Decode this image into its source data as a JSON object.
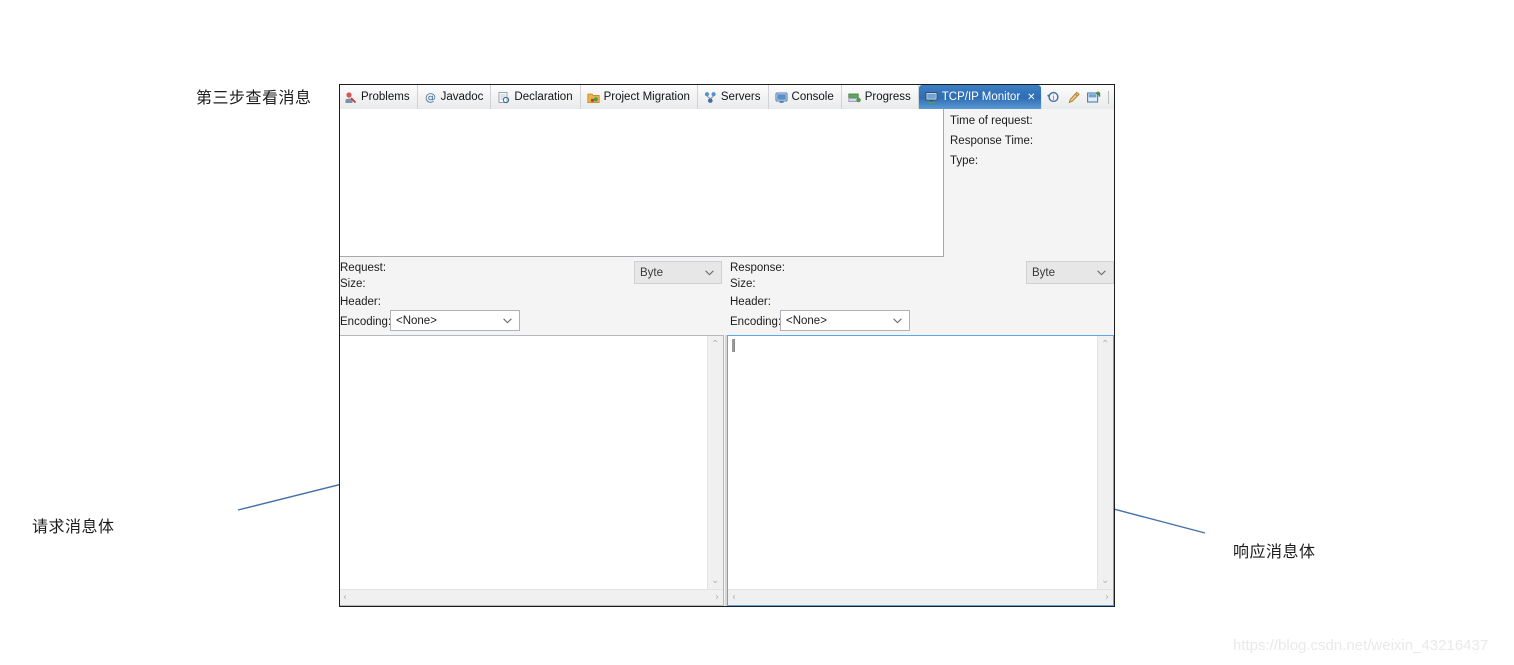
{
  "annotations": {
    "step3": "第三步查看消息",
    "request_body": "请求消息体",
    "response_body": "响应消息体"
  },
  "watermark": "https://blog.csdn.net/weixin_43216437",
  "tabs": [
    {
      "label": "Problems",
      "icon": "problems-icon",
      "active": false
    },
    {
      "label": "Javadoc",
      "icon": "javadoc-icon",
      "active": false
    },
    {
      "label": "Declaration",
      "icon": "declaration-icon",
      "active": false
    },
    {
      "label": "Project Migration",
      "icon": "project-migration-icon",
      "active": false
    },
    {
      "label": "Servers",
      "icon": "servers-icon",
      "active": false
    },
    {
      "label": "Console",
      "icon": "console-icon",
      "active": false
    },
    {
      "label": "Progress",
      "icon": "progress-icon",
      "active": false
    },
    {
      "label": "TCP/IP Monitor",
      "icon": "tcpip-monitor-icon",
      "active": true,
      "close": "✕"
    }
  ],
  "toolbar": {
    "items": [
      {
        "name": "properties-icon"
      },
      {
        "name": "clear-icon"
      },
      {
        "name": "pin-icon"
      },
      {
        "name": "preferences-icon"
      }
    ],
    "view_menu": "▽",
    "minimize": "▭",
    "maximize": "❐"
  },
  "info": {
    "time_of_request": "Time of request:",
    "response_time": "Response Time:",
    "type": "Type:"
  },
  "request": {
    "title": "Request:",
    "size": "Size:",
    "header": "Header:",
    "encoding_label": "Encoding:",
    "encoding_value": "<None>",
    "view_value": "Byte",
    "body": ""
  },
  "response": {
    "title": "Response:",
    "size": "Size:",
    "header": "Header:",
    "encoding_label": "Encoding:",
    "encoding_value": "<None>",
    "view_value": "Byte",
    "body": ""
  },
  "scrollbars": {
    "up": "⌃",
    "down": "⌄",
    "left": "‹",
    "right": "›"
  },
  "colors": {
    "active_tab": "#2f6fb5",
    "focus_border": "#5aa8e8",
    "arrow": "#4472a8",
    "window_border": "#1d1d1d",
    "panel_bg": "#f4f4f4"
  }
}
